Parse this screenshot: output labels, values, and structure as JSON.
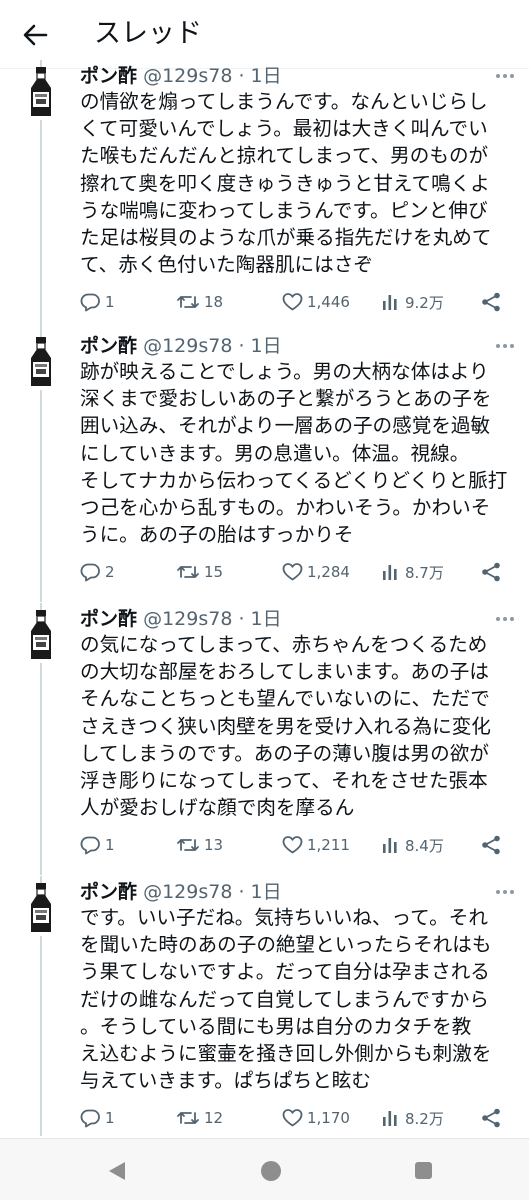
{
  "header": {
    "title": "スレッド"
  },
  "tweets": [
    {
      "name": "ポン酢",
      "meta": "@129s78 · 1日",
      "lines": [
        "の情欲を煽ってしまうんです。なんといじらし",
        "くて可愛いんでしょう。最初は大きく叫んでい",
        "た喉もだんだんと掠れてしまって、男のものが",
        "擦れて奥を叩く度きゅうきゅうと甘えて鳴くよ",
        "うな喘鳴に変わってしまうんです。ピンと伸び",
        "た足は桜貝のような爪が乗る指先だけを丸めて",
        "て、赤く色付いた陶器肌にはさぞ"
      ],
      "replies": "1",
      "retweets": "18",
      "likes": "1,446",
      "views": "9.2万"
    },
    {
      "name": "ポン酢",
      "meta": "@129s78 · 1日",
      "lines": [
        "跡が映えることでしょう。男の大柄な体はより",
        "深くまで愛おしいあの子と繋がろうとあの子を",
        "囲い込み、それがより一層あの子の感覚を過敏",
        "にしていきます。男の息遣い。体温。視線。",
        "そしてナカから伝わってくるどくりどくりと脈打",
        "つ己を心から乱すもの。かわいそう。かわいそ",
        "うに。あの子の胎はすっかりそ"
      ],
      "replies": "2",
      "retweets": "15",
      "likes": "1,284",
      "views": "8.7万"
    },
    {
      "name": "ポン酢",
      "meta": "@129s78 · 1日",
      "lines": [
        "の気になってしまって、赤ちゃんをつくるため",
        "の大切な部屋をおろしてしまいます。あの子は",
        "そんなことちっとも望んでいないのに、ただで",
        "さえきつく狭い肉壁を男を受け入れる為に変化",
        "してしまうのです。あの子の薄い腹は男の欲が",
        "浮き彫りになってしまって、それをさせた張本",
        "人が愛おしげな顔で肉を摩るん"
      ],
      "replies": "1",
      "retweets": "13",
      "likes": "1,211",
      "views": "8.4万"
    },
    {
      "name": "ポン酢",
      "meta": "@129s78 · 1日",
      "lines": [
        "です。いい子だね。気持ちいいね、って。それ",
        "を聞いた時のあの子の絶望といったらそれはも",
        "う果てしないですよ。だって自分は孕まされる",
        "だけの雌なんだって自覚してしまうんですから",
        "。そうしている間にも男は自分のカタチを教",
        "え込むように蜜壷を掻き回し外側からも刺激を",
        "与えていきます。ぱちぱちと眩む"
      ],
      "replies": "1",
      "retweets": "12",
      "likes": "1,170",
      "views": "8.2万"
    }
  ]
}
